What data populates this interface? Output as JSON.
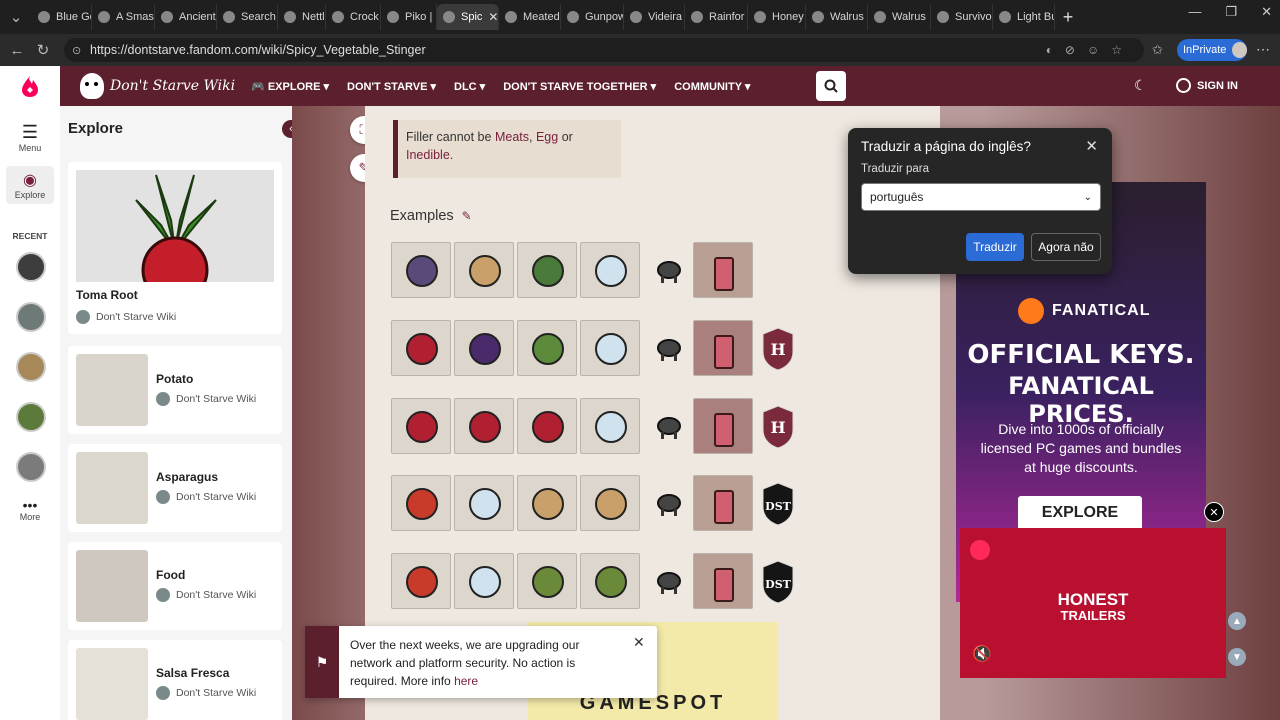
{
  "browser": {
    "tabs": [
      {
        "label": "Blue Ge"
      },
      {
        "label": "A Smash"
      },
      {
        "label": "Ancient"
      },
      {
        "label": "Search F"
      },
      {
        "label": "Nettle |"
      },
      {
        "label": "Crock P"
      },
      {
        "label": "Piko | D"
      },
      {
        "label": "Spic"
      },
      {
        "label": "Meated"
      },
      {
        "label": "Gunpow"
      },
      {
        "label": "Videira"
      },
      {
        "label": "Rainfor"
      },
      {
        "label": "Honey"
      },
      {
        "label": "Walrus"
      },
      {
        "label": "Walrus"
      },
      {
        "label": "Survivo"
      },
      {
        "label": "Light Bu"
      }
    ],
    "url": "https://dontstarve.fandom.com/wiki/Spicy_Vegetable_Stinger",
    "inprivate_label": "InPrivate"
  },
  "site": {
    "logo_text": "Don't Starve Wiki",
    "nav": [
      {
        "label": "EXPLORE"
      },
      {
        "label": "DON'T STARVE"
      },
      {
        "label": "DLC"
      },
      {
        "label": "DON'T STARVE TOGETHER"
      },
      {
        "label": "COMMUNITY"
      }
    ],
    "sign_in_label": "SIGN IN"
  },
  "rail": {
    "menu_label": "Menu",
    "explore_label": "Explore",
    "recent_label": "RECENT",
    "more_label": "More"
  },
  "explore_panel": {
    "title": "Explore",
    "cards": [
      {
        "title": "Toma Root",
        "source": "Don't Starve Wiki"
      },
      {
        "title": "Potato",
        "source": "Don't Starve Wiki"
      },
      {
        "title": "Asparagus",
        "source": "Don't Starve Wiki"
      },
      {
        "title": "Food",
        "source": "Don't Starve Wiki"
      },
      {
        "title": "Salsa Fresca",
        "source": "Don't Starve Wiki"
      }
    ]
  },
  "article": {
    "filler_text_pre": "Filler cannot be",
    "filler_meats": "Meats",
    "filler_egg": "Egg",
    "filler_or": "or",
    "filler_inedible": "Inedible.",
    "examples_heading": "Examples"
  },
  "translate_popup": {
    "title": "Traduzir a página do inglês?",
    "label": "Traduzir para",
    "language": "português",
    "translate_button": "Traduzir",
    "not_now_button": "Agora não"
  },
  "ad_fanatical": {
    "brand": "FANATICAL",
    "headline1": "OFFICIAL KEYS.",
    "headline2": "FANATICAL PRICES.",
    "body": "Dive into 1000s of officially licensed PC games and bundles at huge discounts.",
    "cta": "EXPLORE"
  },
  "video_ad": {
    "title1": "HONEST",
    "title2": "TRAILERS"
  },
  "notice": {
    "text": "Over the next weeks, we are upgrading our network and platform security. No action is required. More info",
    "link": "here"
  },
  "gamespot_text": "GAMESPOT",
  "colors": {
    "header_bg": "#5b1f2e",
    "link": "#7a1f3d",
    "translate_blue": "#2b6bd6"
  }
}
